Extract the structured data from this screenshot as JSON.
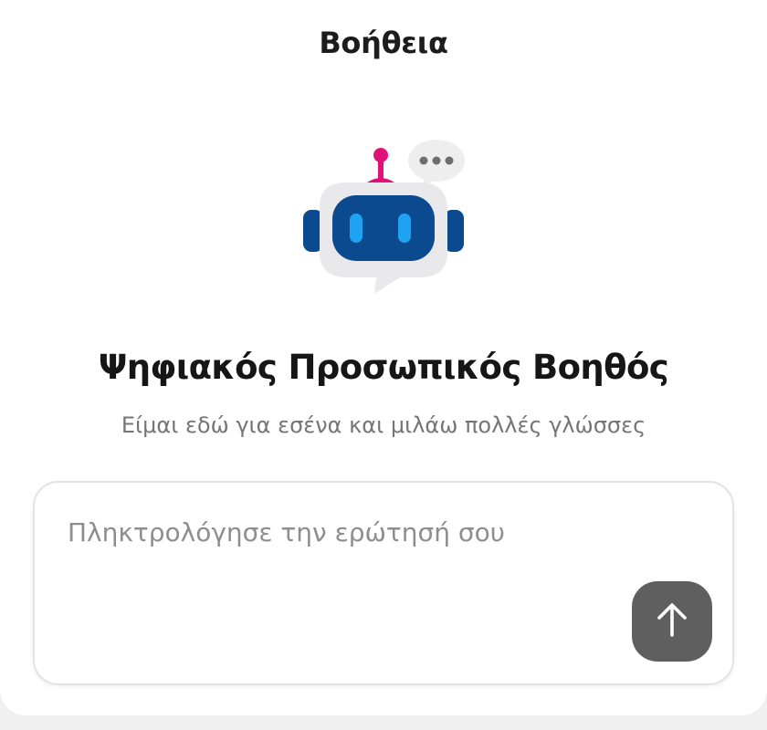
{
  "header": {
    "title": "Βοήθεια"
  },
  "assistant": {
    "icon": "robot-chat-icon",
    "title": "Ψηφιακός Προσωπικός Βοηθός",
    "subtitle": "Είμαι εδώ για εσένα και μιλάω πολλές γλώσσες"
  },
  "composer": {
    "placeholder": "Πληκτρολόγησε την ερώτησή σου",
    "value": "",
    "send_icon": "arrow-up-icon"
  },
  "colors": {
    "robot_blue": "#0b4a8f",
    "robot_eye": "#1ea3f2",
    "antenna": "#e0127a",
    "send_button": "#5f5f5f"
  }
}
